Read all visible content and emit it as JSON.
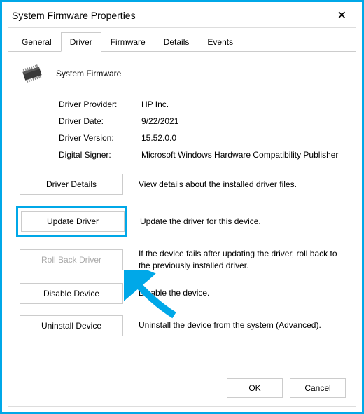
{
  "window": {
    "title": "System Firmware Properties"
  },
  "tabs": {
    "general": "General",
    "driver": "Driver",
    "firmware": "Firmware",
    "details": "Details",
    "events": "Events"
  },
  "device": {
    "name": "System Firmware"
  },
  "info": {
    "provider_label": "Driver Provider:",
    "provider_value": "HP Inc.",
    "date_label": "Driver Date:",
    "date_value": "9/22/2021",
    "version_label": "Driver Version:",
    "version_value": "15.52.0.0",
    "signer_label": "Digital Signer:",
    "signer_value": "Microsoft Windows Hardware Compatibility Publisher"
  },
  "actions": {
    "details_btn": "Driver Details",
    "details_desc": "View details about the installed driver files.",
    "update_btn": "Update Driver",
    "update_desc": "Update the driver for this device.",
    "rollback_btn": "Roll Back Driver",
    "rollback_desc": "If the device fails after updating the driver, roll back to the previously installed driver.",
    "disable_btn": "Disable Device",
    "disable_desc": "Disable the device.",
    "uninstall_btn": "Uninstall Device",
    "uninstall_desc": "Uninstall the device from the system (Advanced)."
  },
  "buttons": {
    "ok": "OK",
    "cancel": "Cancel"
  }
}
